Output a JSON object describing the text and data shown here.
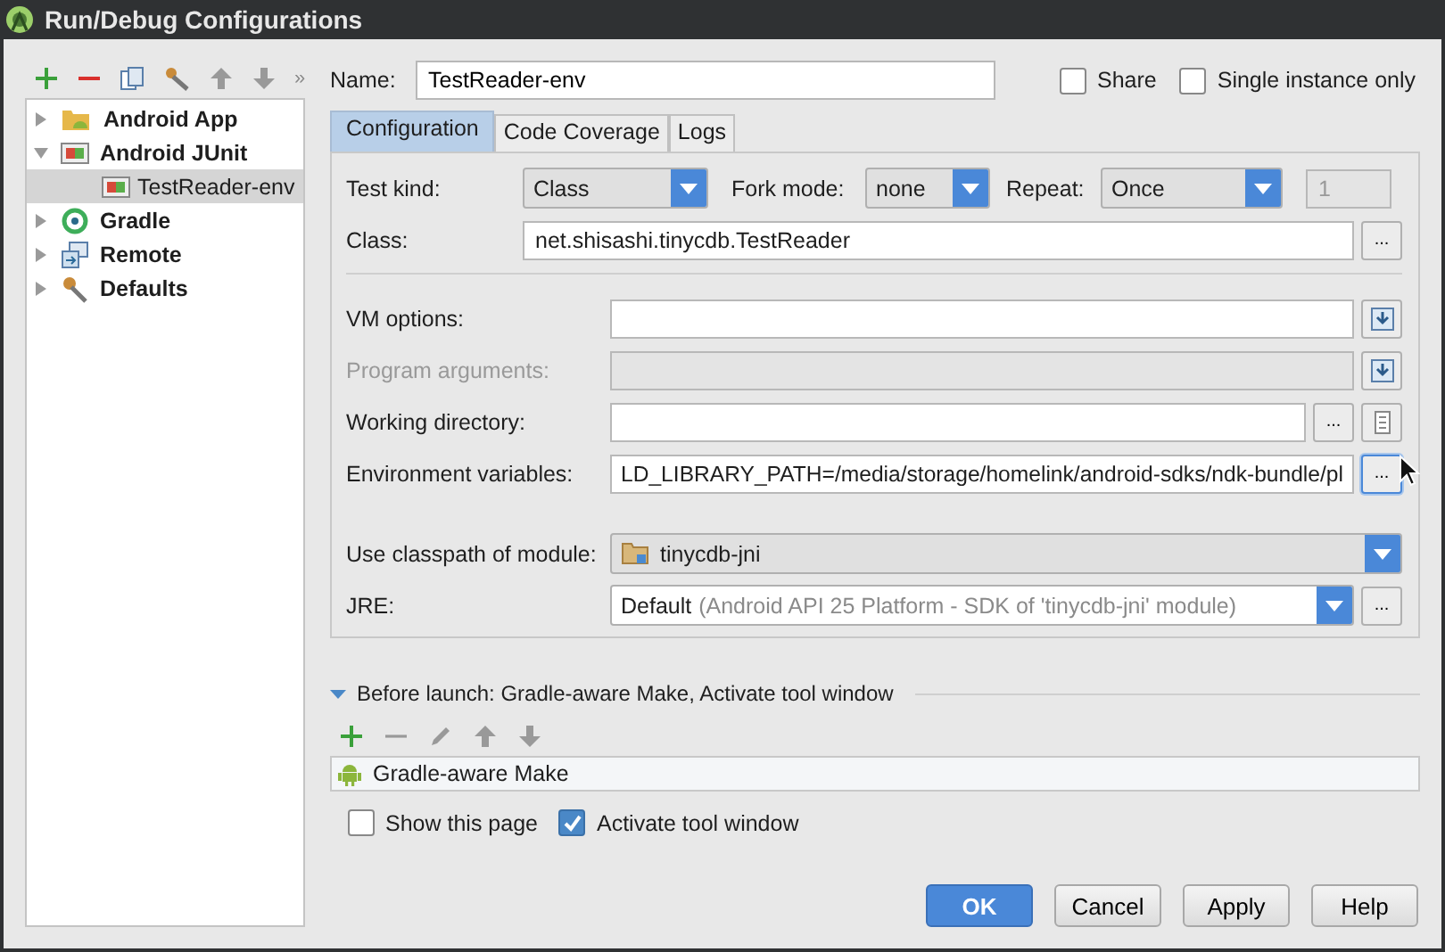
{
  "window": {
    "title": "Run/Debug Configurations"
  },
  "sidebar": {
    "more": "»",
    "tree": [
      {
        "label": "Android App",
        "kind": "app",
        "expanded": false,
        "selected": false
      },
      {
        "label": "Android JUnit",
        "kind": "junit",
        "expanded": true,
        "selected": false,
        "children": [
          {
            "label": "TestReader-env",
            "kind": "junit",
            "selected": true
          }
        ]
      },
      {
        "label": "Gradle",
        "kind": "gradle",
        "expanded": false,
        "selected": false
      },
      {
        "label": "Remote",
        "kind": "remote",
        "expanded": false,
        "selected": false
      },
      {
        "label": "Defaults",
        "kind": "defaults",
        "expanded": false,
        "selected": false
      }
    ]
  },
  "name": {
    "label": "Name:",
    "value": "TestReader-env"
  },
  "share": {
    "label": "Share",
    "checked": false
  },
  "single_instance": {
    "label": "Single instance only",
    "checked": false
  },
  "tabs": [
    {
      "label": "Configuration",
      "selected": true
    },
    {
      "label": "Code Coverage",
      "selected": false
    },
    {
      "label": "Logs",
      "selected": false
    }
  ],
  "test_kind": {
    "label": "Test kind:",
    "value": "Class"
  },
  "fork_mode": {
    "label": "Fork mode:",
    "value": "none"
  },
  "repeat": {
    "label": "Repeat:",
    "value": "Once",
    "count": "1",
    "count_disabled": true
  },
  "class": {
    "label": "Class:",
    "value": "net.shisashi.tinycdb.TestReader",
    "button": "..."
  },
  "vm_options": {
    "label": "VM options:",
    "disabled": false
  },
  "program_arguments": {
    "label": "Program arguments:",
    "disabled": true
  },
  "working_directory": {
    "label": "Working directory:",
    "button": "..."
  },
  "environment_variables": {
    "label": "Environment variables:",
    "value": "LD_LIBRARY_PATH=/media/storage/homelink/android-sdks/ndk-bundle/pl",
    "button": "..."
  },
  "module": {
    "label": "Use classpath of module:",
    "value": "tinycdb-jni"
  },
  "jre": {
    "label": "JRE:",
    "value": "Default",
    "hint": "(Android API 25 Platform - SDK of 'tinycdb-jni' module)",
    "button": "..."
  },
  "before_launch": {
    "label": "Before launch: Gradle-aware Make, Activate tool window",
    "expanded": true,
    "tasks": [
      {
        "label": "Gradle-aware Make"
      }
    ]
  },
  "show_this_page": {
    "label": "Show this page",
    "checked": false
  },
  "activate_tool_window": {
    "label": "Activate tool window",
    "checked": true
  },
  "buttons": [
    {
      "label": "OK",
      "default": true
    },
    {
      "label": "Cancel",
      "default": false
    },
    {
      "label": "Apply",
      "default": false
    },
    {
      "label": "Help",
      "default": false
    }
  ]
}
